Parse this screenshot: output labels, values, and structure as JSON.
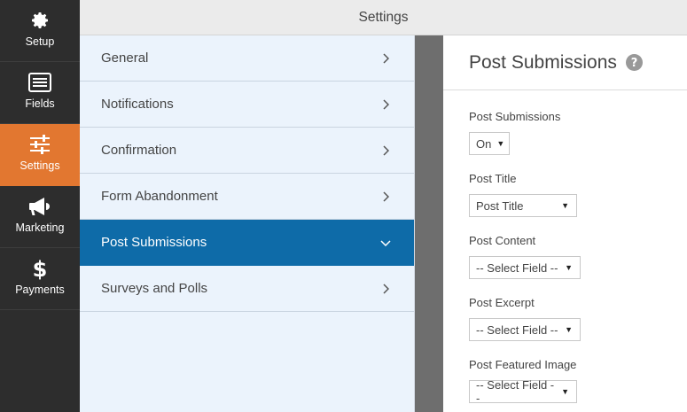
{
  "app": {
    "title": "Settings"
  },
  "rail": {
    "items": [
      {
        "label": "Setup",
        "icon": "gear-icon"
      },
      {
        "label": "Fields",
        "icon": "list-icon"
      },
      {
        "label": "Settings",
        "icon": "sliders-icon",
        "active": true
      },
      {
        "label": "Marketing",
        "icon": "megaphone-icon"
      },
      {
        "label": "Payments",
        "icon": "dollar-icon"
      }
    ]
  },
  "sections": {
    "items": [
      {
        "label": "General"
      },
      {
        "label": "Notifications"
      },
      {
        "label": "Confirmation"
      },
      {
        "label": "Form Abandonment"
      },
      {
        "label": "Post Submissions",
        "active": true
      },
      {
        "label": "Surveys and Polls"
      }
    ]
  },
  "panel": {
    "title": "Post Submissions",
    "fields": [
      {
        "label": "Post Submissions",
        "value": "On"
      },
      {
        "label": "Post Title",
        "value": "Post Title"
      },
      {
        "label": "Post Content",
        "value": "-- Select Field --"
      },
      {
        "label": "Post Excerpt",
        "value": "-- Select Field --"
      },
      {
        "label": "Post Featured Image",
        "value": "-- Select Field --"
      }
    ]
  },
  "colors": {
    "rail_bg": "#2d2d2d",
    "active_orange": "#e27730",
    "active_blue": "#0e6ba8",
    "section_bg": "#ebf3fc"
  }
}
